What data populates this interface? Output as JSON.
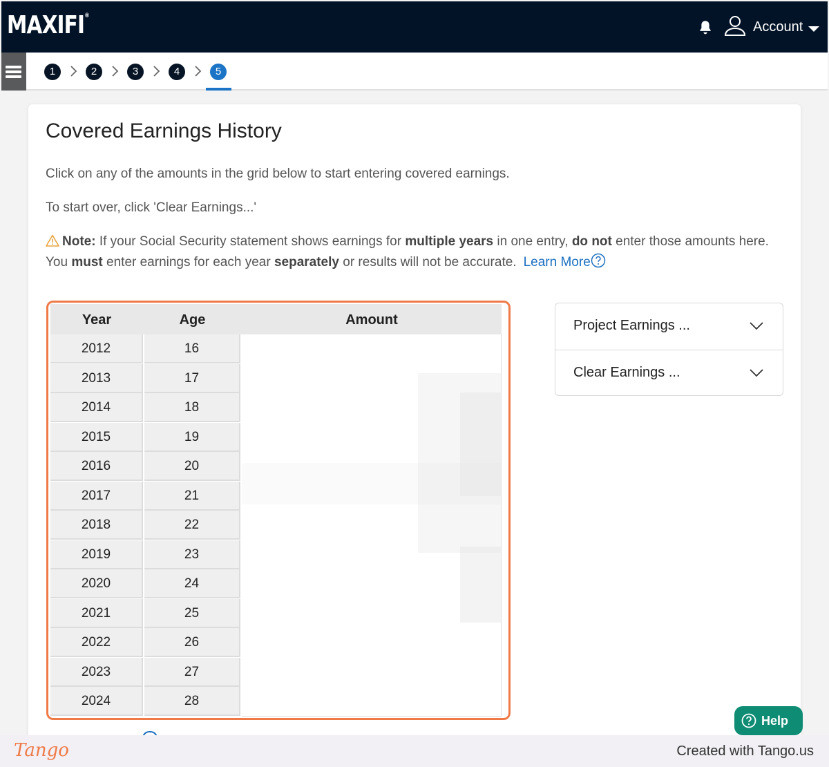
{
  "header": {
    "logo": "MAXIFI",
    "logo_mark": "®",
    "account_label": "Account",
    "icons": {
      "bell": "bell-icon",
      "user": "user-icon",
      "caret": "caret-down-icon"
    }
  },
  "stepper": {
    "steps": [
      "1",
      "2",
      "3",
      "4",
      "5"
    ],
    "active_step": "5",
    "colors": {
      "active": "#1b74c5",
      "inactive": "#061425"
    }
  },
  "page": {
    "title": "Covered Earnings History",
    "instruction": "Click on any of the amounts in the grid below to start entering covered earnings.",
    "start_over": "To start over, click 'Clear Earnings...'",
    "note": {
      "label": "Note:",
      "t1": " If your Social Security statement shows earnings for ",
      "b1": "multiple years",
      "t2": " in one entry, ",
      "b2": "do not",
      "t3": " enter those amounts here. You ",
      "b3": "must",
      "t4": " enter earnings for each year ",
      "b4": "separately",
      "t5": " or results will not be accurate."
    },
    "learn_more": "Learn More"
  },
  "grid": {
    "headers": {
      "year": "Year",
      "age": "Age",
      "amount": "Amount"
    },
    "rows": [
      {
        "year": "2012",
        "age": "16"
      },
      {
        "year": "2013",
        "age": "17"
      },
      {
        "year": "2014",
        "age": "18"
      },
      {
        "year": "2015",
        "age": "19"
      },
      {
        "year": "2016",
        "age": "20"
      },
      {
        "year": "2017",
        "age": "21"
      },
      {
        "year": "2018",
        "age": "22"
      },
      {
        "year": "2019",
        "age": "23"
      },
      {
        "year": "2020",
        "age": "24"
      },
      {
        "year": "2021",
        "age": "25"
      },
      {
        "year": "2022",
        "age": "26"
      },
      {
        "year": "2023",
        "age": "27"
      },
      {
        "year": "2024",
        "age": "28"
      }
    ],
    "highlight_color": "#ef7a47"
  },
  "actions": {
    "project_earnings": "Project Earnings ...",
    "clear_earnings": "Clear Earnings ..."
  },
  "help": {
    "label": "Help",
    "color": "#0e8c74"
  },
  "footer": {
    "brand": "Tango",
    "created": "Created with Tango.us"
  }
}
